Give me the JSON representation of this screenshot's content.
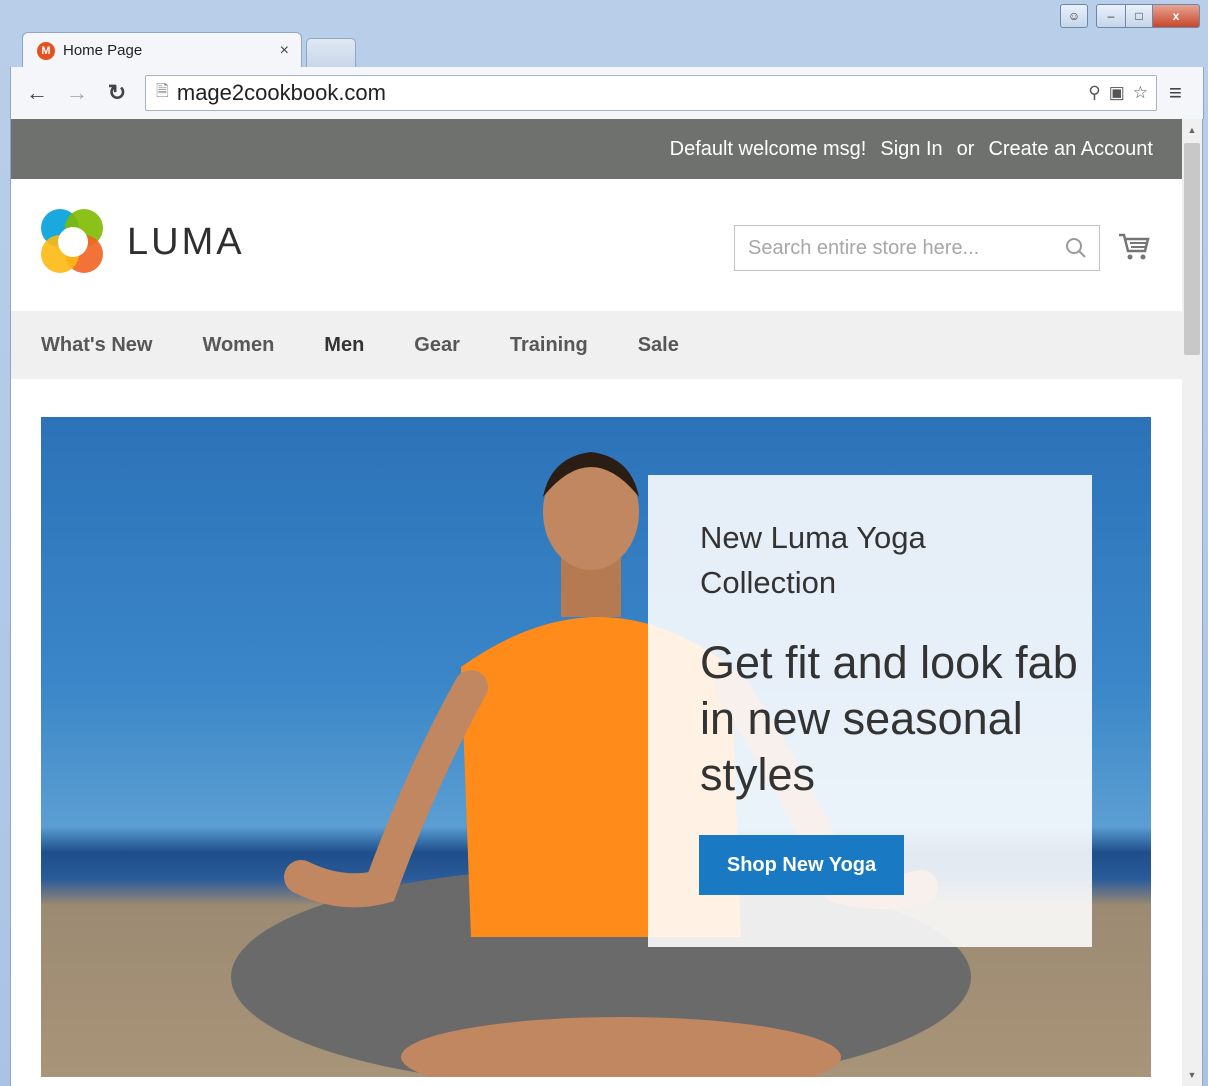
{
  "browser": {
    "tab": {
      "title": "Home Page",
      "close": "×"
    },
    "address": {
      "url": "mage2cookbook.com"
    },
    "window_controls": {
      "minimize": "–",
      "maximize": "□",
      "close": "x"
    }
  },
  "page": {
    "panel": {
      "welcome": "Default welcome msg!",
      "sign_in": "Sign In",
      "or": "or",
      "create_account": "Create an Account"
    },
    "logo": {
      "text": "LUMA"
    },
    "search": {
      "placeholder": "Search entire store here..."
    },
    "nav": {
      "items": [
        {
          "label": "What's New"
        },
        {
          "label": "Women"
        },
        {
          "label": "Men"
        },
        {
          "label": "Gear"
        },
        {
          "label": "Training"
        },
        {
          "label": "Sale"
        }
      ]
    },
    "hero": {
      "subtitle": "New Luma Yoga Collection",
      "title": "Get fit and look fab in new seasonal styles",
      "button": "Shop New Yoga"
    }
  },
  "colors": {
    "panel_bg": "#6e716e",
    "nav_bg": "#f0f0f0",
    "button": "#1979c3",
    "logo": [
      "#f26322",
      "#00a0dc",
      "#7fba00",
      "#fdb913"
    ]
  }
}
